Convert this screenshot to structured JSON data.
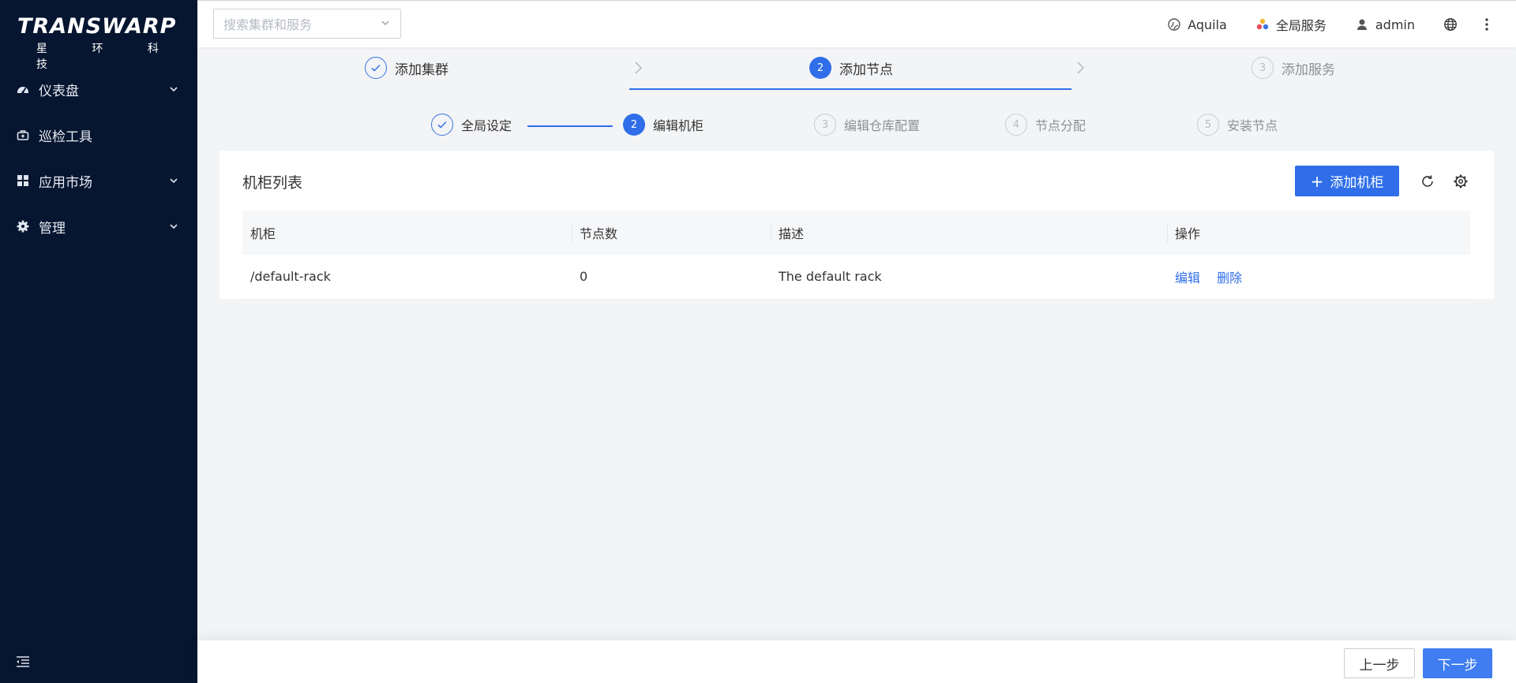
{
  "brand": {
    "name": "TRANSWARP",
    "subtitle": "星 环 科 技"
  },
  "sidebar": {
    "items": [
      {
        "label": "仪表盘",
        "icon": "dashboard-icon",
        "expandable": true
      },
      {
        "label": "巡检工具",
        "icon": "toolbox-icon",
        "expandable": false
      },
      {
        "label": "应用市场",
        "icon": "apps-grid-icon",
        "expandable": true
      },
      {
        "label": "管理",
        "icon": "gear-icon",
        "expandable": true
      }
    ]
  },
  "header": {
    "search_placeholder": "搜索集群和服务",
    "cluster": "Aquila",
    "global_services": "全局服务",
    "user": "admin"
  },
  "wizard": {
    "steps": [
      {
        "num": "1",
        "label": "添加集群",
        "status": "done"
      },
      {
        "num": "2",
        "label": "添加节点",
        "status": "active"
      },
      {
        "num": "3",
        "label": "添加服务",
        "status": "todo"
      }
    ],
    "substeps": [
      {
        "num": "1",
        "label": "全局设定",
        "status": "done"
      },
      {
        "num": "2",
        "label": "编辑机柜",
        "status": "active"
      },
      {
        "num": "3",
        "label": "编辑仓库配置",
        "status": "todo"
      },
      {
        "num": "4",
        "label": "节点分配",
        "status": "todo"
      },
      {
        "num": "5",
        "label": "安装节点",
        "status": "todo"
      }
    ]
  },
  "rack_list": {
    "title": "机柜列表",
    "add_button": "添加机柜",
    "columns": [
      "机柜",
      "节点数",
      "描述",
      "操作"
    ],
    "rows": [
      {
        "rack": "/default-rack",
        "nodes": "0",
        "description": "The default rack",
        "actions": [
          "编辑",
          "删除"
        ]
      }
    ]
  },
  "footer": {
    "prev": "上一步",
    "next": "下一步"
  },
  "colors": {
    "sidebar_bg": "#061530",
    "primary": "#2f6ee8"
  }
}
